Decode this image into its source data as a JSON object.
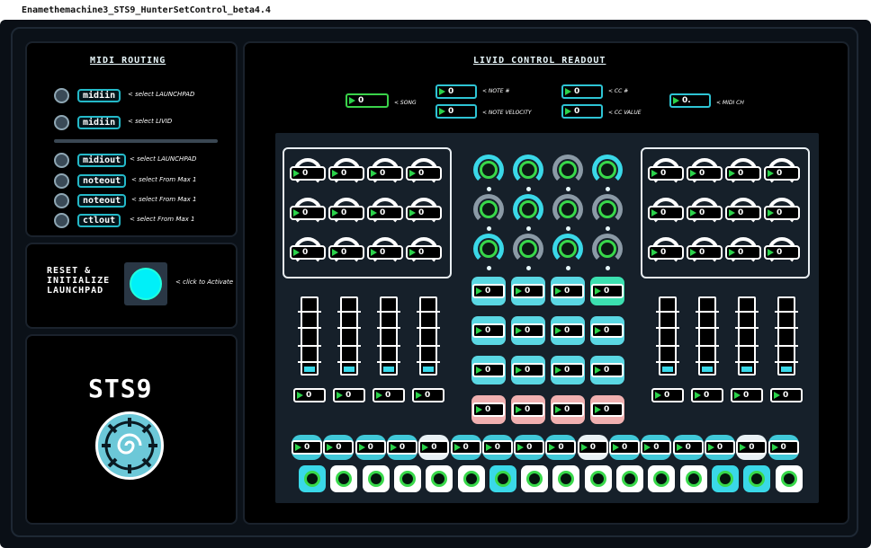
{
  "window": {
    "title": "Enamethemachine3_STS9_HunterSetControl_beta4.4"
  },
  "midi_routing": {
    "title": "MIDI ROUTING",
    "rows": [
      {
        "box": "midiin",
        "label": "< select LAUNCHPAD"
      },
      {
        "box": "midiin",
        "label": "< select LIVID"
      },
      {
        "box": "midiout",
        "label": "< select LAUNCHPAD"
      },
      {
        "box": "noteout",
        "label": "< select From Max 1"
      },
      {
        "box": "noteout",
        "label": "< select From Max 1"
      },
      {
        "box": "ctlout",
        "label": "< select From Max 1"
      }
    ]
  },
  "reset": {
    "title_line1": "RESET &",
    "title_line2": "INITIALIZE",
    "title_line3": "LAUNCHPAD",
    "hint": "< click to Activate"
  },
  "logo": {
    "text": "STS9"
  },
  "readout": {
    "title": "LIVID CONTROL READOUT",
    "song": {
      "value": "0",
      "label": "< SONG"
    },
    "note": {
      "value": "0",
      "label": "< NOTE #"
    },
    "note_velocity": {
      "value": "0",
      "label": "< NOTE VELOCITY"
    },
    "cc": {
      "value": "0",
      "label": "< CC #"
    },
    "cc_value": {
      "value": "0",
      "label": "< CC VALUE"
    },
    "midi_ch": {
      "value": "0.",
      "label": "< MIDI CH"
    }
  },
  "device": {
    "encoder_value": "0",
    "pad_value": "0",
    "fader_value": "0",
    "button_value": "0"
  },
  "colors": {
    "accent": "#2ec4d4",
    "green": "#38d84a",
    "background": "#000000"
  }
}
